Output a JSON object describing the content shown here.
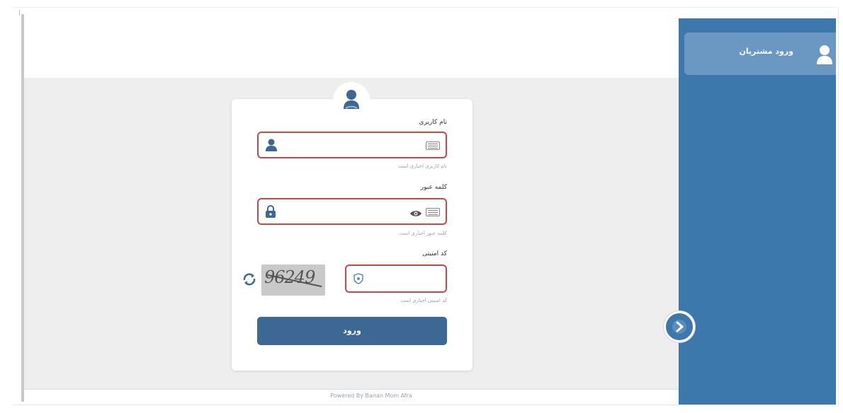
{
  "sidebar": {
    "menu_item_label": "ورود مشتریان",
    "bg_color": "#3d78ad",
    "item_bg_color": "#6b98c2"
  },
  "login": {
    "username_label": "نام کاربری",
    "username_value": "",
    "username_error": "نام کاربری اجباری است",
    "password_label": "کلمه عبور",
    "password_value": "",
    "password_error": "کلمه عبور اجباری است",
    "captcha_label": "کد امنیتی",
    "captcha_value": "",
    "captcha_error": "کد امنیتی اجباری است",
    "captcha_image_text": "96249",
    "submit_label": "ورود",
    "error_color": "#c9474c",
    "button_color": "#3d6896"
  },
  "footer": {
    "text": "Powered By Banan Mom Afra"
  },
  "icons": {
    "sidebar_user": "user-icon",
    "card_avatar": "user-avatar-icon",
    "username_field": "user-icon",
    "password_field": "lock-icon",
    "password_toggle": "eye-icon",
    "keyboard": "keyboard-icon",
    "captcha_field": "shield-icon",
    "captcha_refresh": "refresh-icon",
    "sidebar_toggle": "chevron-right-icon"
  }
}
